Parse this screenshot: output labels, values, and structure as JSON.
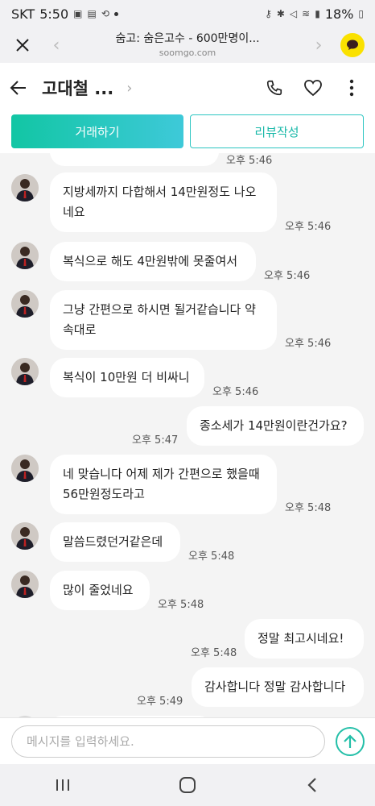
{
  "status": {
    "carrier": "SKT",
    "time": "5:50",
    "battery": "18%"
  },
  "browser": {
    "title": "숨고: 숨은고수 - 600만명이...",
    "url": "soomgo.com"
  },
  "chat": {
    "partner_name": "고대철 ...",
    "deal_button": "거래하기",
    "review_button": "리뷰작성"
  },
  "messages": [
    {
      "from": "them",
      "text": "지방세까지 다합해서 14만원정도 나오네요",
      "time": "오후 5:46"
    },
    {
      "from": "them",
      "text": "복식으로 해도 4만원밖에 못줄여서",
      "time": "오후 5:46"
    },
    {
      "from": "them",
      "text": "그냥 간편으로 하시면 될거같습니다 약속대로",
      "time": "오후 5:46"
    },
    {
      "from": "them",
      "text": "복식이 10만원 더 비싸니",
      "time": "오후 5:46"
    },
    {
      "from": "me",
      "text": "종소세가 14만원이란건가요?",
      "time": "오후 5:47"
    },
    {
      "from": "them",
      "text": "네 맞습니다 어제 제가 간편으로 했을때 56만원정도라고",
      "time": "오후 5:48"
    },
    {
      "from": "them",
      "text": "말씀드렸던거같은데",
      "time": "오후 5:48"
    },
    {
      "from": "them",
      "text": "많이 줄었네요",
      "time": "오후 5:48"
    },
    {
      "from": "me",
      "text": "정말  최고시네요!",
      "time": "오후 5:48"
    },
    {
      "from": "me",
      "text": "감사합니다 정말 감사합니다",
      "time": "오후 5:49"
    }
  ],
  "top_partial_time": "오후 5:46",
  "input": {
    "placeholder": "메시지를 입력하세요."
  },
  "colors": {
    "accent": "#1fc1b0",
    "kakao": "#fae100"
  },
  "icons": [
    "close-icon",
    "back-arrow-icon",
    "forward-arrow-icon",
    "kakao-icon",
    "back-icon",
    "chevron-right-icon",
    "phone-icon",
    "heart-icon",
    "more-icon",
    "send-icon",
    "recent-apps-icon",
    "home-icon",
    "nav-back-icon"
  ]
}
